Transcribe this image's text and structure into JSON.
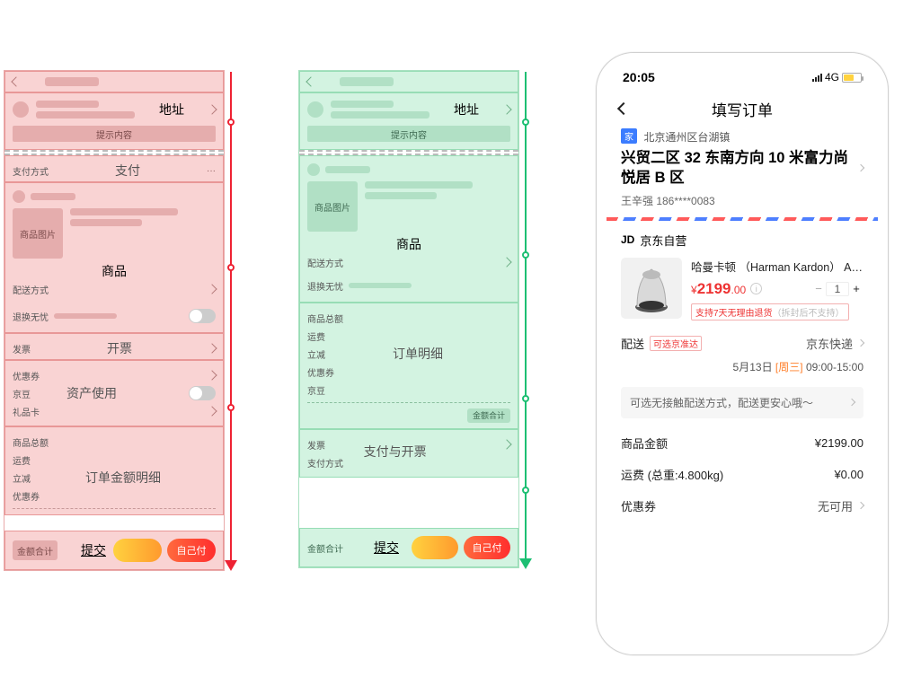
{
  "red": {
    "addressTitle": "地址",
    "addressHint": "提示内容",
    "paymentLeft": "支付方式",
    "paymentTitle": "支付",
    "productImgLabel": "商品图片",
    "productTitle": "商品",
    "deliveryMethod": "配送方式",
    "returnFree": "退换无忧",
    "invoiceTitle": "开票",
    "invoiceLeft": "发票",
    "assetsTitle": "资产使用",
    "coupon": "优惠券",
    "jdBean": "京豆",
    "giftCard": "礼品卡",
    "orderDetailTitle": "订单金额明细",
    "goodsTotal": "商品总额",
    "freight": "运费",
    "discount": "立减",
    "coupon2": "优惠券",
    "totalLabel": "金额合计",
    "submitTitle": "提交",
    "selfPay": "自己付"
  },
  "green": {
    "addressTitle": "地址",
    "addressHint": "提示内容",
    "productImgLabel": "商品图片",
    "productTitle": "商品",
    "deliveryMethod": "配送方式",
    "returnFree": "退换无忧",
    "orderDetailTitle": "订单明细",
    "goodsTotal": "商品总额",
    "freight": "运费",
    "discount": "立减",
    "coupon": "优惠券",
    "jdBean": "京豆",
    "totalSmall": "金额合计",
    "payInvoiceTitle": "支付与开票",
    "invoice": "发票",
    "payMethod": "支付方式",
    "totalLabel": "金额合计",
    "submitTitle": "提交",
    "selfPay": "自己付"
  },
  "phone": {
    "time": "20:05",
    "network": "4G",
    "title": "填写订单",
    "addrTag": "家",
    "addrArea": "北京通州区台湖镇",
    "addrDetail": "兴贸二区 32 东南方向 10 米富力尚悦居 B 区",
    "addrContact": "王辛强  186****0083",
    "storeBadge": "JD",
    "storeName": "京东自营",
    "productName": "哈曼卡顿 （Harman Kardon） Aura St...",
    "priceSymbol": "¥",
    "priceMain": "2199",
    "priceSub": ".00",
    "qty": "1",
    "returnBadge": "支持7天无理由退货",
    "returnBadgeGray": "（拆封后不支持）",
    "shipLabel": "配送",
    "shipFast": "可选京准达",
    "shipCarrier": "京东快递",
    "shipDate": "5月13日",
    "shipWeekday": "[周三]",
    "shipTime": "09:00-15:00",
    "notice": "可选无接触配送方式，配送更安心哦～",
    "sumGoodsLabel": "商品金额",
    "sumGoodsValue": "¥2199.00",
    "sumFreightLabel": "运费 (总重:4.800kg)",
    "sumFreightValue": "¥0.00",
    "sumCouponLabel": "优惠券",
    "sumCouponValue": "无可用"
  }
}
